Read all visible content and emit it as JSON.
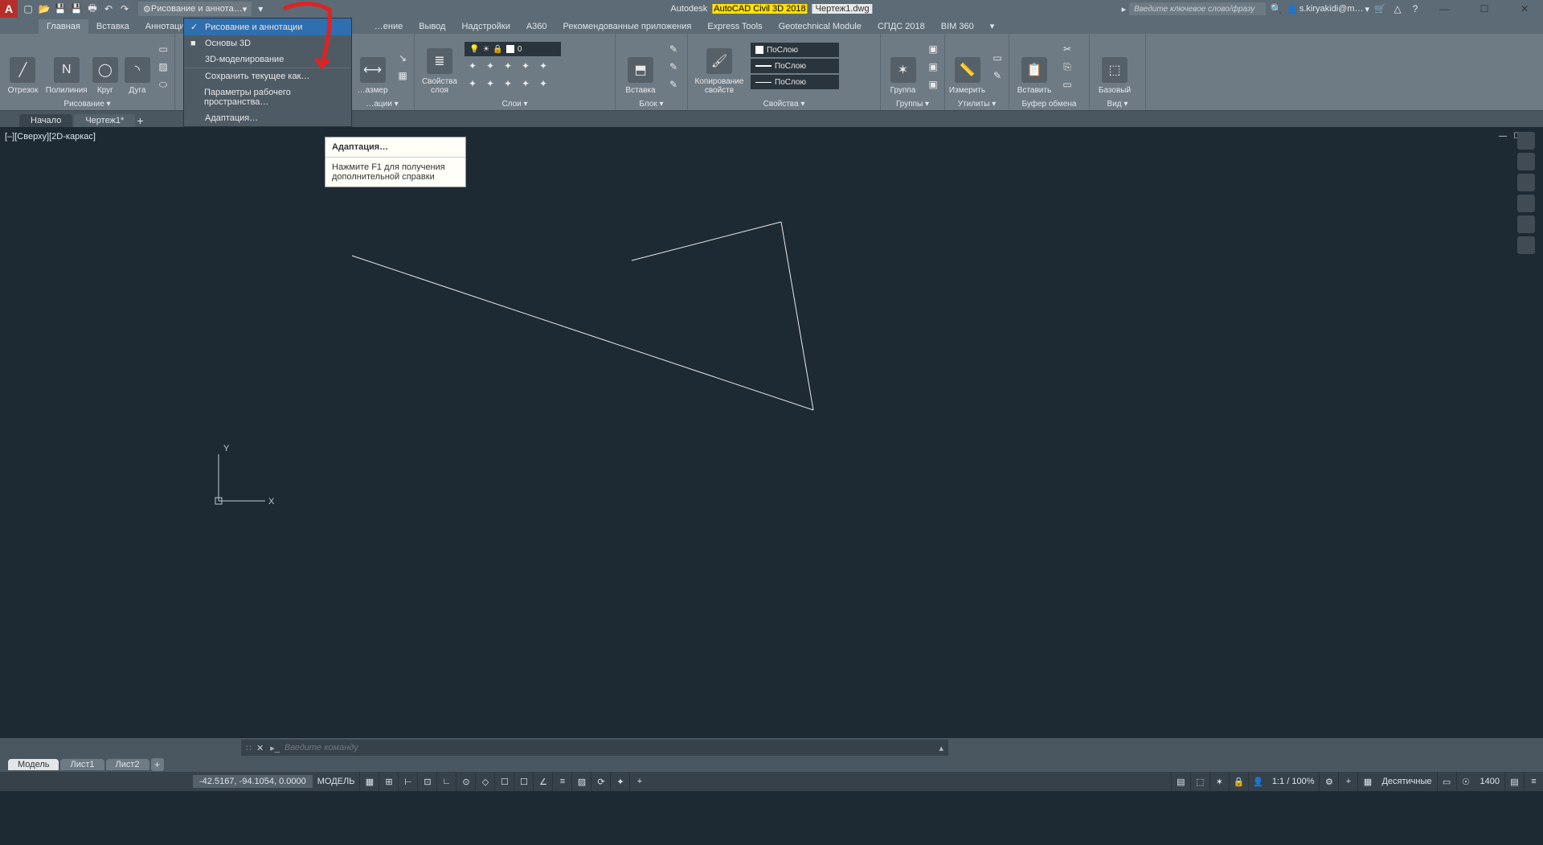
{
  "titlebar": {
    "workspace_label": "Рисование и аннота…",
    "product_prefix": "Autodesk ",
    "product_hl": "AutoCAD Civil 3D 2018",
    "doc": "Чертеж1.dwg",
    "search_placeholder": "Введите ключевое слово/фразу",
    "user": "s.kiryakidi@m…"
  },
  "ribbon_tabs": [
    "Главная",
    "Вставка",
    "Аннотации",
    "…ение",
    "Вывод",
    "Надстройки",
    "A360",
    "Рекомендованные приложения",
    "Express Tools",
    "Geotechnical Module",
    "СПДС 2018",
    "BIM 360"
  ],
  "ribbon": {
    "draw": {
      "line": "Отрезок",
      "pline": "Полилиния",
      "circle": "Круг",
      "arc": "Дуга",
      "title": "Рисование ▾"
    },
    "modify": {
      "title": "…ации ▾"
    },
    "dim": {
      "btn": "…азмер"
    },
    "layers": {
      "btn": "Свойства\nслоя",
      "current": "0",
      "title": "Слои ▾"
    },
    "block": {
      "insert": "Вставка",
      "title": "Блок ▾"
    },
    "props": {
      "copy": "Копирование\nсвойств",
      "bylayer1": "ПоСлою",
      "bylayer2": "ПоСлою",
      "bylayer3": "ПоСлою",
      "title": "Свойства ▾"
    },
    "group": {
      "btn": "Группа",
      "title": "Группы ▾"
    },
    "util": {
      "btn": "Измерить",
      "title": "Утилиты ▾"
    },
    "clip": {
      "btn": "Вставить",
      "title": "Буфер обмена"
    },
    "view": {
      "btn": "Базовый",
      "title": "Вид ▾"
    }
  },
  "ws_menu": [
    "Рисование и аннотации",
    "Основы 3D",
    "3D-моделирование",
    "Сохранить текущее как…",
    "Параметры рабочего пространства…",
    "Адаптация…"
  ],
  "tooltip": {
    "title": "Адаптация…",
    "body": "Нажмите F1 для получения дополнительной справки"
  },
  "doc_tabs": {
    "start": "Начало",
    "active": "Чертеж1*"
  },
  "view_label": "[–][Сверху][2D-каркас]",
  "cmd": {
    "placeholder": "Введите команду"
  },
  "layout_tabs": [
    "Модель",
    "Лист1",
    "Лист2"
  ],
  "status": {
    "coords": "-42.5167, -94.1054, 0.0000",
    "space": "МОДЕЛЬ",
    "scale": "1:1 / 100%",
    "units": "Десятичные",
    "num": "1400"
  }
}
